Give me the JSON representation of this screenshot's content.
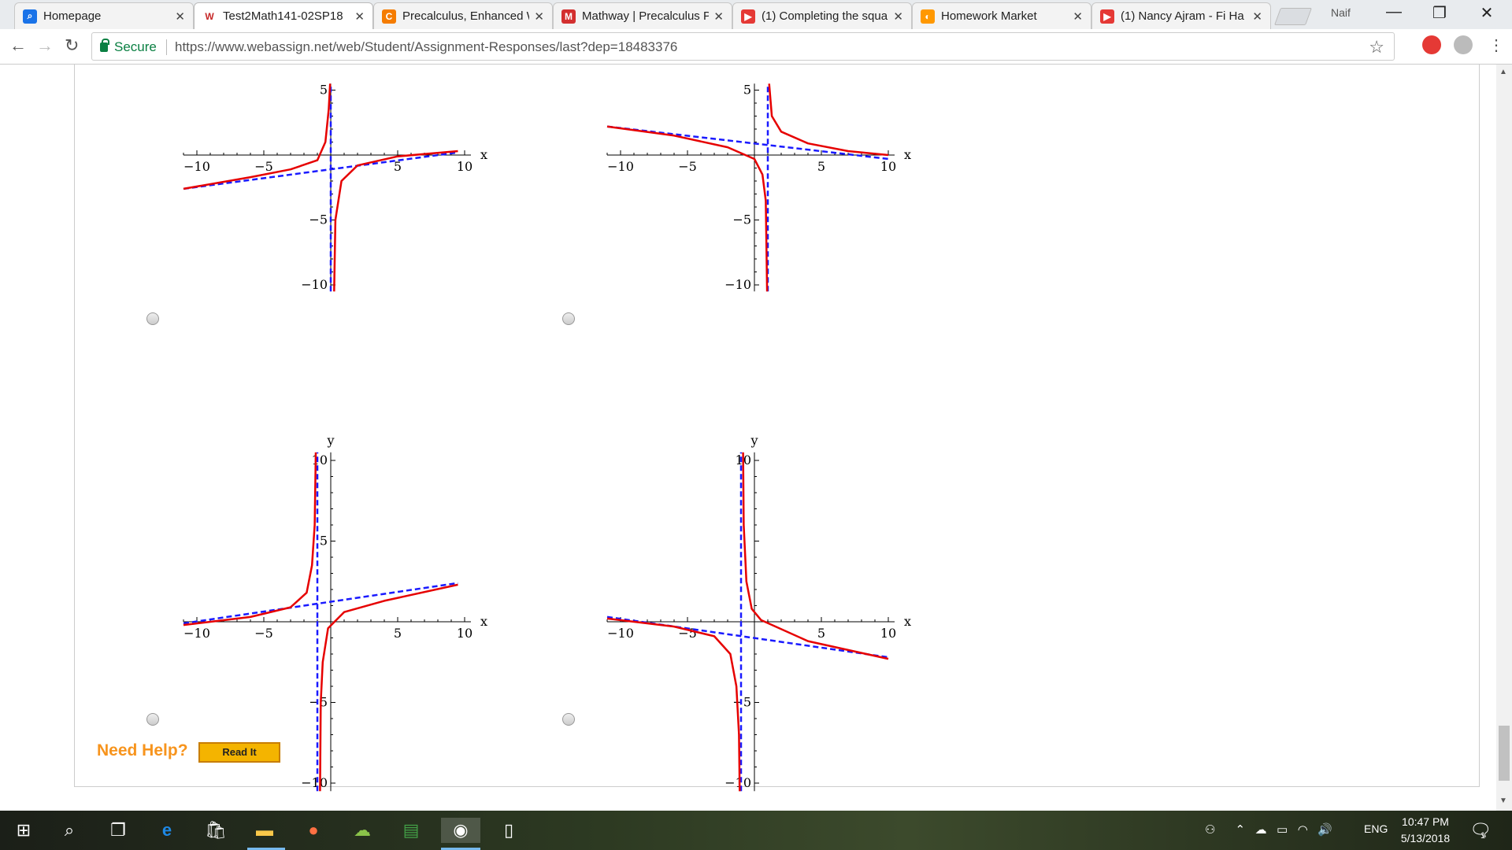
{
  "tabs": [
    {
      "title": "Homepage",
      "icon": "search-icon",
      "color": "#1a73e8"
    },
    {
      "title": "Test2Math141-02SP18",
      "icon": "webassign-icon",
      "color": "#c62828"
    },
    {
      "title": "Precalculus, Enhanced W",
      "icon": "cengage-icon",
      "color": "#f57c00"
    },
    {
      "title": "Mathway | Precalculus P",
      "icon": "mathway-icon",
      "color": "#d32f2f"
    },
    {
      "title": "(1) Completing the squa",
      "icon": "youtube-icon",
      "color": "#e53935"
    },
    {
      "title": "Homework Market",
      "icon": "homework-market-icon",
      "color": "#ff9800"
    },
    {
      "title": "(1) Nancy Ajram - Fi Ha",
      "icon": "youtube-icon",
      "color": "#e53935"
    }
  ],
  "profile_name": "Naif",
  "secure_label": "Secure",
  "url": "https://www.webassign.net/web/Student/Assignment-Responses/last?dep=18483376",
  "chart_data": [
    {
      "type": "line",
      "id": "graph-a",
      "x_ticks": [
        -10,
        -5,
        5,
        10
      ],
      "y_ticks": [
        5,
        -5,
        -10
      ],
      "xlabel": "x",
      "ylabel": "",
      "xlim": [
        -11,
        10
      ],
      "ylim": [
        -10.5,
        5.5
      ],
      "asymptote_v": 0,
      "asymptote_line": {
        "x": [
          -11,
          9.5
        ],
        "y": [
          -2.6,
          0.2
        ]
      },
      "curve_left": [
        [
          -11,
          -2.6
        ],
        [
          -6,
          -1.7
        ],
        [
          -3,
          -1.1
        ],
        [
          -1,
          -0.4
        ],
        [
          -0.4,
          1.0
        ],
        [
          -0.15,
          3.5
        ],
        [
          -0.05,
          5.5
        ]
      ],
      "curve_right": [
        [
          0.25,
          -10.5
        ],
        [
          0.35,
          -5
        ],
        [
          0.8,
          -2.0
        ],
        [
          2,
          -0.8
        ],
        [
          5,
          -0.1
        ],
        [
          9.5,
          0.3
        ]
      ]
    },
    {
      "type": "line",
      "id": "graph-b",
      "x_ticks": [
        -10,
        -5,
        5,
        10
      ],
      "y_ticks": [
        5,
        -5,
        -10
      ],
      "xlabel": "x",
      "ylabel": "",
      "xlim": [
        -11,
        10
      ],
      "ylim": [
        -10.5,
        5.5
      ],
      "asymptote_v": 1,
      "asymptote_line": {
        "x": [
          -11,
          10
        ],
        "y": [
          2.2,
          -0.3
        ]
      },
      "curve_left": [
        [
          -11,
          2.2
        ],
        [
          -6,
          1.5
        ],
        [
          -2,
          0.6
        ],
        [
          0,
          -0.3
        ],
        [
          0.6,
          -1.5
        ],
        [
          0.85,
          -3.5
        ],
        [
          0.95,
          -10.5
        ]
      ],
      "curve_right": [
        [
          1.1,
          5.5
        ],
        [
          1.3,
          3
        ],
        [
          2,
          1.8
        ],
        [
          4,
          0.9
        ],
        [
          7,
          0.3
        ],
        [
          10,
          0
        ]
      ]
    },
    {
      "type": "line",
      "id": "graph-c",
      "x_ticks": [
        -10,
        -5,
        5,
        10
      ],
      "y_ticks": [
        10,
        5,
        -5,
        -10
      ],
      "xlabel": "x",
      "ylabel": "y",
      "xlim": [
        -11,
        10
      ],
      "ylim": [
        -10.5,
        10.5
      ],
      "asymptote_v": -1,
      "asymptote_line": {
        "x": [
          -11,
          9.5
        ],
        "y": [
          -0.1,
          2.4
        ]
      },
      "curve_left": [
        [
          -11,
          -0.2
        ],
        [
          -6,
          0.3
        ],
        [
          -3,
          0.9
        ],
        [
          -1.8,
          1.8
        ],
        [
          -1.4,
          3.5
        ],
        [
          -1.2,
          6
        ],
        [
          -1.12,
          10.5
        ]
      ],
      "curve_right": [
        [
          -0.8,
          -10.5
        ],
        [
          -0.75,
          -5
        ],
        [
          -0.6,
          -2.5
        ],
        [
          -0.2,
          -0.4
        ],
        [
          1,
          0.6
        ],
        [
          4,
          1.3
        ],
        [
          9.5,
          2.3
        ]
      ]
    },
    {
      "type": "line",
      "id": "graph-d",
      "x_ticks": [
        -10,
        -5,
        5,
        10
      ],
      "y_ticks": [
        10,
        -5,
        -10
      ],
      "xlabel": "x",
      "ylabel": "y",
      "xlim": [
        -11,
        10
      ],
      "ylim": [
        -10.5,
        10.5
      ],
      "asymptote_v": -1,
      "asymptote_line": {
        "x": [
          -11,
          10
        ],
        "y": [
          0.3,
          -2.2
        ]
      },
      "curve_left": [
        [
          -11,
          0.2
        ],
        [
          -6,
          -0.3
        ],
        [
          -3,
          -0.9
        ],
        [
          -1.8,
          -2
        ],
        [
          -1.35,
          -4
        ],
        [
          -1.15,
          -7
        ],
        [
          -1.1,
          -10.5
        ]
      ],
      "curve_right": [
        [
          -0.85,
          10.5
        ],
        [
          -0.8,
          6
        ],
        [
          -0.6,
          2.5
        ],
        [
          -0.2,
          0.8
        ],
        [
          0.5,
          0.1
        ],
        [
          4,
          -1.2
        ],
        [
          10,
          -2.3
        ]
      ]
    }
  ],
  "need_help_label": "Need Help?",
  "read_it_label": "Read It",
  "tray": {
    "language": "ENG",
    "time": "10:47 PM",
    "date": "5/13/2018",
    "notification_count": "1"
  }
}
